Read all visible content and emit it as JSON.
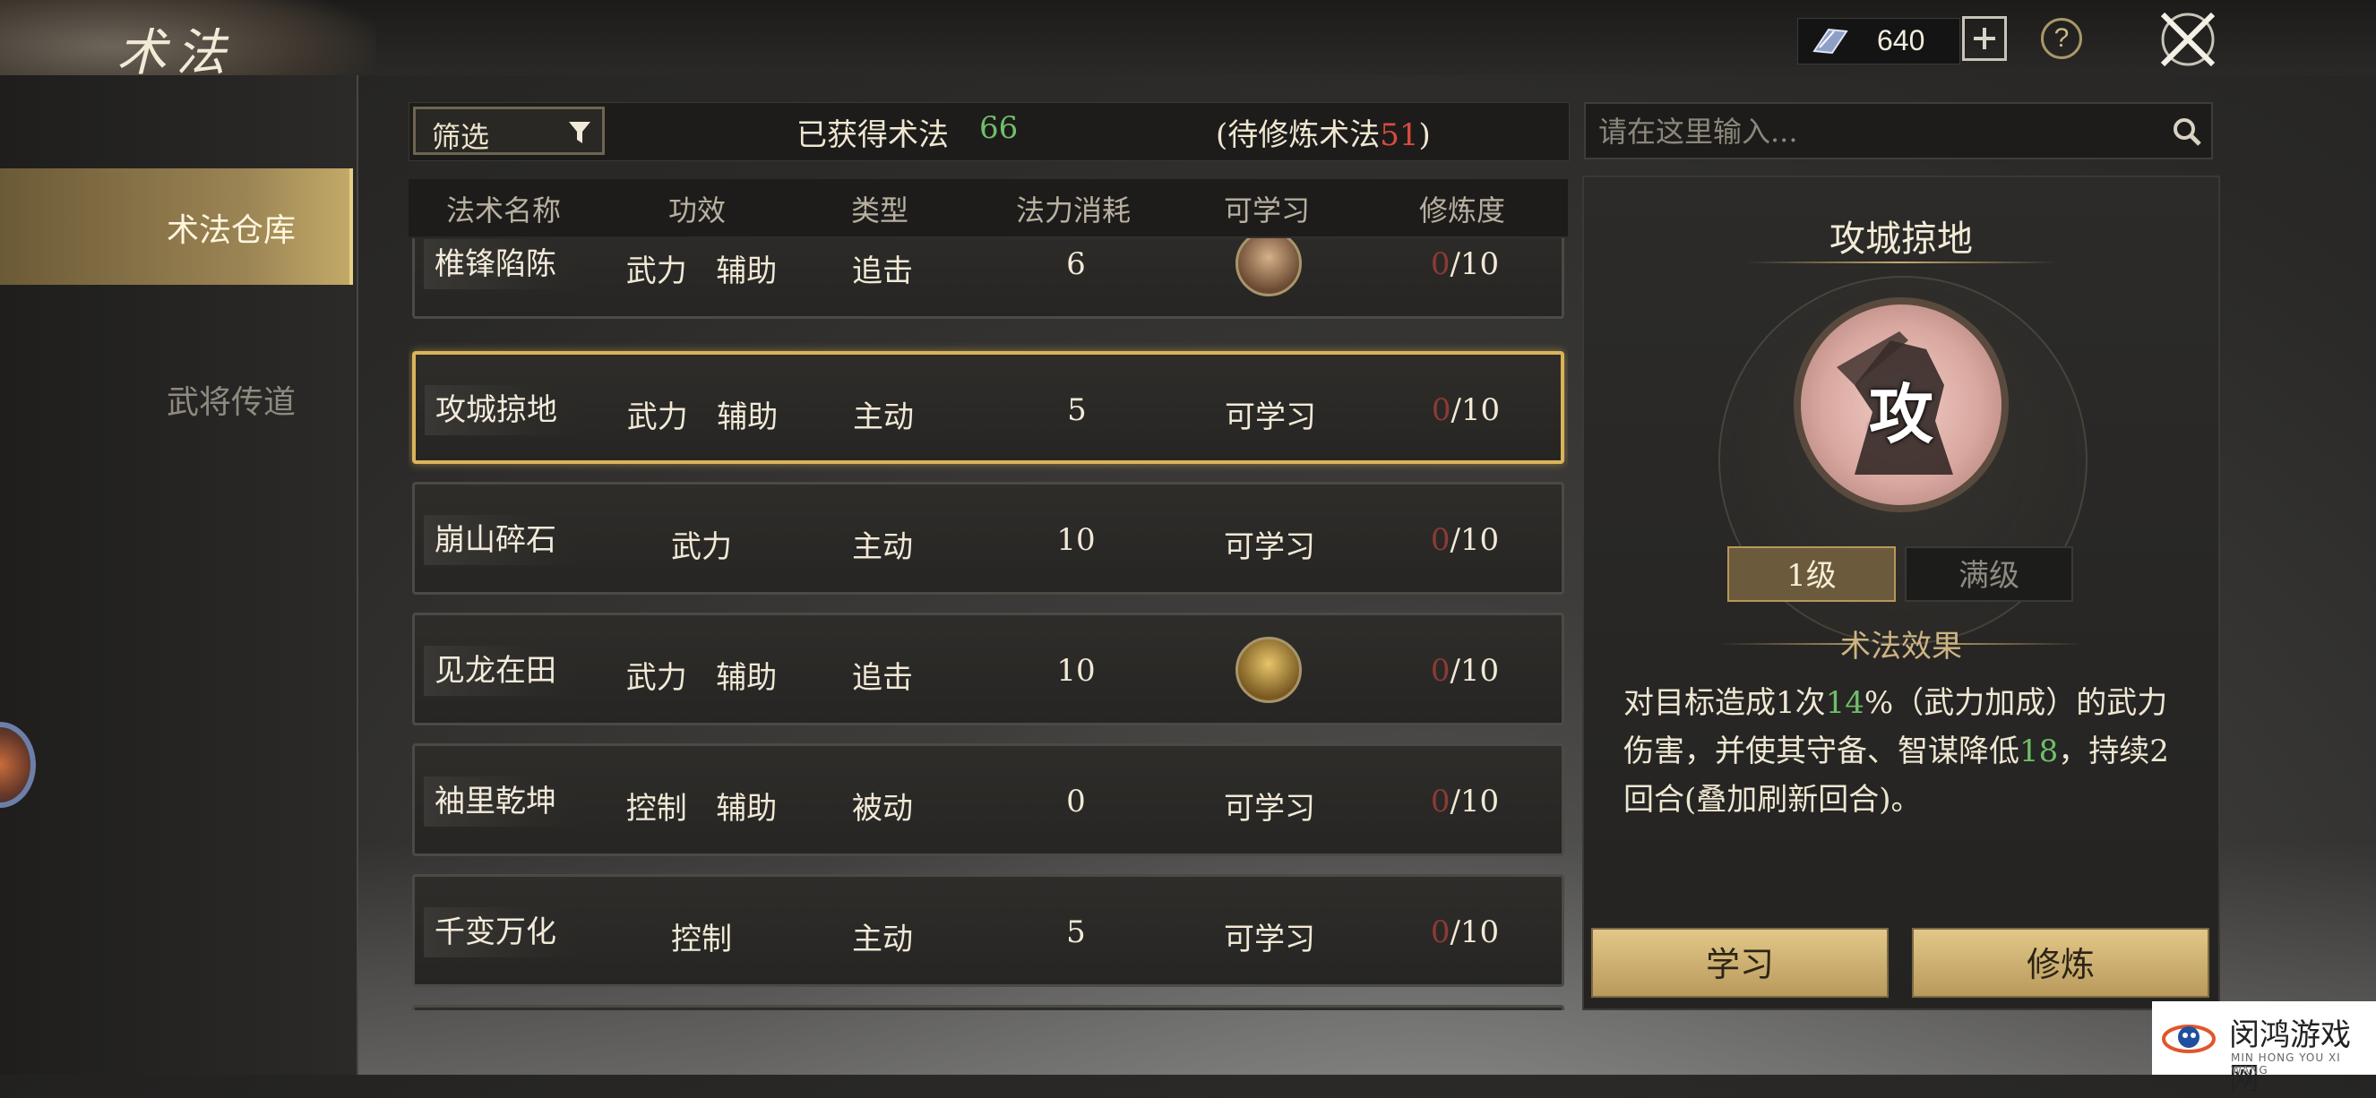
{
  "header": {
    "title": "术法",
    "currency": {
      "icon": "book-icon",
      "value": "640"
    },
    "help_label": "?"
  },
  "sidebar": {
    "items": [
      {
        "label": "术法仓库",
        "active": true
      },
      {
        "label": "武将传道",
        "active": false
      }
    ]
  },
  "filter": {
    "label": "筛选",
    "obtained_label": "已获得术法",
    "obtained_count": "66",
    "pending_open": "(待修炼术法",
    "pending_count": "51",
    "pending_close": ")"
  },
  "search": {
    "placeholder": "请在这里输入..."
  },
  "table": {
    "headers": [
      "法术名称",
      "功效",
      "类型",
      "法力消耗",
      "可学习",
      "修炼度"
    ],
    "rows": [
      {
        "name": "椎锋陷陈",
        "effect": "武力   辅助",
        "type": "追击",
        "cost": "6",
        "learnable": "",
        "learnable_avatar": true,
        "progress_done": "0",
        "progress_total": "/10"
      },
      {
        "name": "攻城掠地",
        "effect": "武力   辅助",
        "type": "主动",
        "cost": "5",
        "learnable": "可学习",
        "learnable_avatar": false,
        "progress_done": "0",
        "progress_total": "/10",
        "selected": true
      },
      {
        "name": "崩山碎石",
        "effect": "武力",
        "type": "主动",
        "cost": "10",
        "learnable": "可学习",
        "learnable_avatar": false,
        "progress_done": "0",
        "progress_total": "/10"
      },
      {
        "name": "见龙在田",
        "effect": "武力   辅助",
        "type": "追击",
        "cost": "10",
        "learnable": "",
        "learnable_avatar": true,
        "progress_done": "0",
        "progress_total": "/10"
      },
      {
        "name": "袖里乾坤",
        "effect": "控制   辅助",
        "type": "被动",
        "cost": "0",
        "learnable": "可学习",
        "learnable_avatar": false,
        "progress_done": "0",
        "progress_total": "/10"
      },
      {
        "name": "千变万化",
        "effect": "控制",
        "type": "主动",
        "cost": "5",
        "learnable": "可学习",
        "learnable_avatar": false,
        "progress_done": "0",
        "progress_total": "/10"
      }
    ]
  },
  "detail": {
    "title": "攻城掠地",
    "icon_char": "攻",
    "levels": [
      "1级",
      "满级"
    ],
    "effect_heading": "术法效果",
    "effect_parts": [
      "对目标造成1次",
      "14",
      "%（武力加成）的武力伤害，并使其守备、智谋降低",
      "18",
      "，持续2回合(叠加刷新回合)。"
    ],
    "buttons": {
      "learn": "学习",
      "train": "修炼"
    }
  },
  "watermark": {
    "title": "闵鸿游戏网",
    "subtitle": "MIN HONG YOU XI WANG"
  },
  "colors": {
    "accent_gold": "#d9b45a",
    "green": "#6fbf6a",
    "red": "#d94b3e"
  }
}
